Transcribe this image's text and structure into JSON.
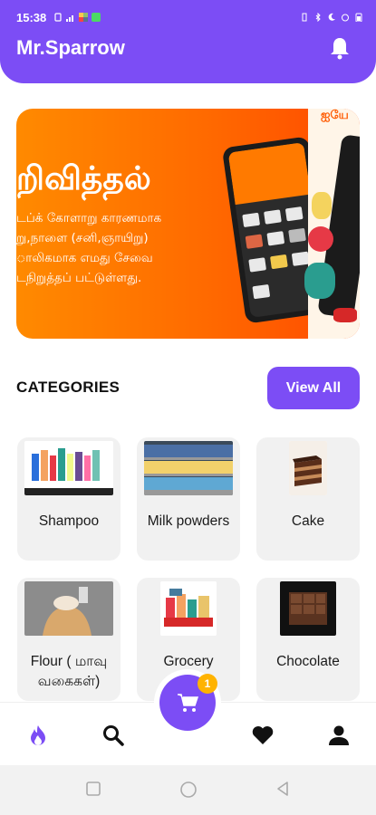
{
  "status_bar": {
    "time": "15:38",
    "left_icons": [
      "vibrate-icon",
      "wifi-signal-icon",
      "app-icon",
      "message-icon"
    ],
    "right_icons": [
      "vibrate-mode-icon",
      "bluetooth-icon",
      "do-not-disturb-icon",
      "alarm-icon",
      "battery-icon"
    ]
  },
  "header": {
    "title": "Mr.Sparrow",
    "notification_icon": "bell-icon"
  },
  "banner": {
    "corner_text": "ஐயே",
    "title": "றிவித்தல்",
    "lines": [
      "டப்க் கோளாறு காரணமாக",
      "று,நாளை (சனி,ஞாயிறு)",
      "ாலிகமாக எமது சேவை",
      "டநிறுத்தப் பட்டுள்ளது."
    ]
  },
  "categories": {
    "heading": "CATEGORIES",
    "view_all_label": "View All",
    "items": [
      {
        "label": "Shampoo"
      },
      {
        "label": "Milk powders"
      },
      {
        "label": "Cake"
      },
      {
        "label": "Flour ( மாவு வகைகள்)"
      },
      {
        "label": "Grocery"
      },
      {
        "label": "Chocolate"
      }
    ]
  },
  "bottom_nav": {
    "items": [
      "flame-icon",
      "search-icon",
      "cart-icon",
      "heart-icon",
      "profile-icon"
    ],
    "cart_badge": "1"
  },
  "colors": {
    "primary": "#7c4df5",
    "banner_orange": "#ff6a00",
    "badge": "#ffb300"
  }
}
